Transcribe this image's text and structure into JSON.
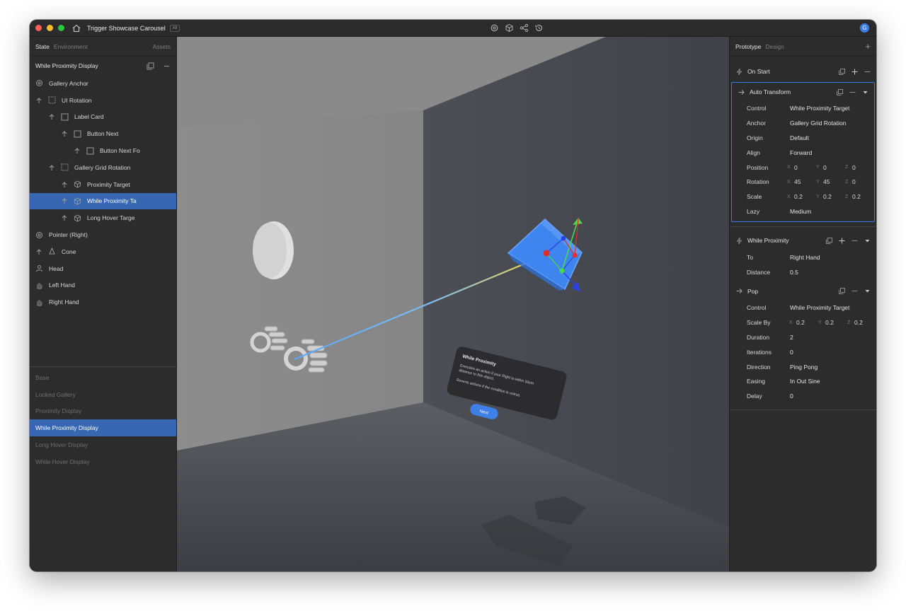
{
  "titlebar": {
    "app_title": "Trigger Showcase Carousel",
    "badge": "All",
    "avatar_letter": "G",
    "tools": [
      "refresh-icon",
      "cube-icon",
      "share-icon",
      "history-icon"
    ]
  },
  "left": {
    "tabs": [
      "State",
      "Environment",
      "Assets"
    ],
    "header": "While Proximity Display",
    "tree": [
      {
        "label": "Gallery Anchor",
        "icon": "anchor-icon",
        "indent": 0,
        "arrow": false
      },
      {
        "label": "UI Rotation",
        "icon": "group-icon",
        "indent": 0,
        "arrow": true
      },
      {
        "label": "Label Card",
        "icon": "square-icon",
        "indent": 1,
        "arrow": true
      },
      {
        "label": "Button Next",
        "icon": "square-icon",
        "indent": 2,
        "arrow": true
      },
      {
        "label": "Button Next Fo",
        "icon": "square-icon",
        "indent": 3,
        "arrow": true
      },
      {
        "label": "Gallery Grid Rotation",
        "icon": "group-icon",
        "indent": 1,
        "arrow": true
      },
      {
        "label": "Proximity Target",
        "icon": "cube-icon",
        "indent": 2,
        "arrow": true
      },
      {
        "label": "While Proximity Ta",
        "icon": "cube-icon",
        "indent": 2,
        "arrow": true,
        "selected": true
      },
      {
        "label": "Long Hover Targe",
        "icon": "cube-icon",
        "indent": 2,
        "arrow": true
      },
      {
        "label": "Pointer (Right)",
        "icon": "anchor-icon",
        "indent": 0,
        "arrow": false
      },
      {
        "label": "Cone",
        "icon": "cone-icon",
        "indent": 0,
        "arrow": true
      },
      {
        "label": "Head",
        "icon": "person-icon",
        "indent": 0,
        "arrow": false
      },
      {
        "label": "Left Hand",
        "icon": "hand-icon",
        "indent": 0,
        "arrow": false
      },
      {
        "label": "Right Hand",
        "icon": "hand-icon",
        "indent": 0,
        "arrow": false
      }
    ],
    "states": [
      {
        "label": "Base"
      },
      {
        "label": "Locked Gallery"
      },
      {
        "label": "Proximity Display"
      },
      {
        "label": "While Proximity Display",
        "selected": true
      },
      {
        "label": "Long Hover Display"
      },
      {
        "label": "While Hover Display"
      }
    ]
  },
  "viewport": {
    "card_title": "While Proximity",
    "card_line1": "Executes an action if your Right is within 50cm",
    "card_line2": "distance to this object.",
    "card_line3": "Reverts actions if the condition is untrue.",
    "card_button": "Next"
  },
  "right": {
    "tabs": [
      "Prototype",
      "Design"
    ],
    "on_start": "On Start",
    "auto_transform": {
      "title": "Auto Transform",
      "rows": [
        {
          "label": "Control",
          "value": "While Proximity Target"
        },
        {
          "label": "Anchor",
          "value": "Gallery Grid Rotation"
        },
        {
          "label": "Origin",
          "value": "Default"
        },
        {
          "label": "Align",
          "value": "Forward"
        }
      ],
      "position": {
        "label": "Position",
        "x": "0",
        "y": "0",
        "z": "0"
      },
      "rotation": {
        "label": "Rotation",
        "x": "45",
        "y": "45",
        "z": "0"
      },
      "scale": {
        "label": "Scale",
        "x": "0.2",
        "y": "0.2",
        "z": "0.2"
      },
      "lazy": {
        "label": "Lazy",
        "value": "Medium"
      }
    },
    "while_proximity": {
      "title": "While Proximity",
      "rows": [
        {
          "label": "To",
          "value": "Right Hand"
        },
        {
          "label": "Distance",
          "value": "0.5"
        }
      ]
    },
    "pop": {
      "title": "Pop",
      "control": {
        "label": "Control",
        "value": "While Proximity Target"
      },
      "scale_by": {
        "label": "Scale By",
        "x": "0.2",
        "y": "0.2",
        "z": "0.2"
      },
      "rows": [
        {
          "label": "Duration",
          "value": "2"
        },
        {
          "label": "Iterations",
          "value": "0"
        },
        {
          "label": "Direction",
          "value": "Ping Pong"
        },
        {
          "label": "Easing",
          "value": "In Out Sine"
        },
        {
          "label": "Delay",
          "value": "0"
        }
      ]
    },
    "axis_labels": {
      "x": "X",
      "y": "Y",
      "z": "Z"
    }
  }
}
